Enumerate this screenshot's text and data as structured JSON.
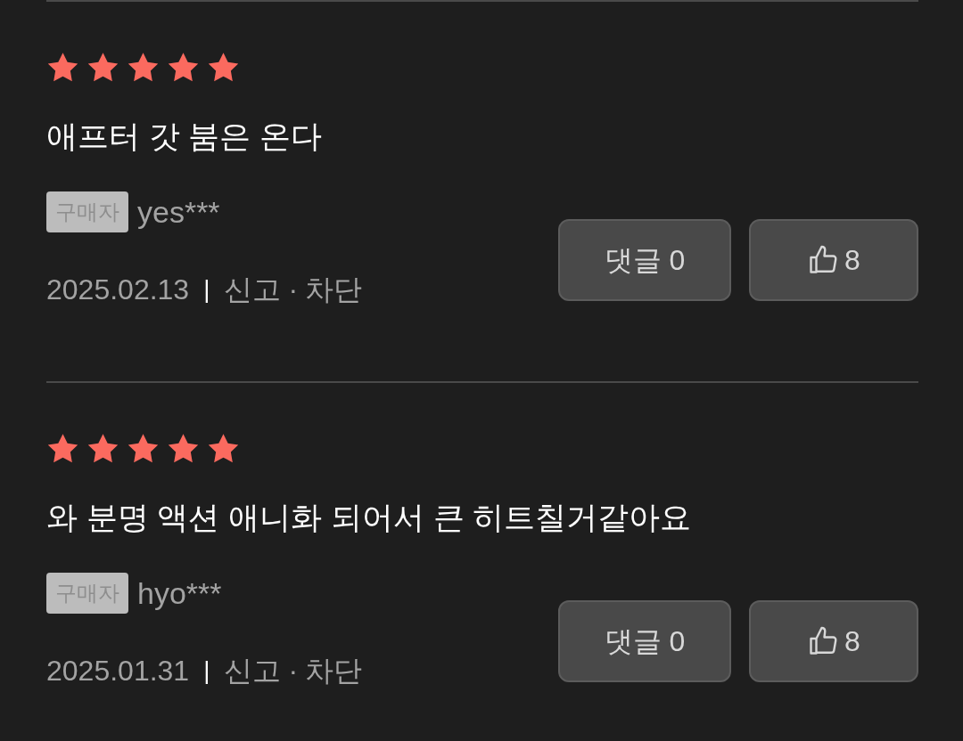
{
  "reviews": [
    {
      "stars": 5,
      "text": "애프터 갓 붐은 온다",
      "badge": "구매자",
      "user": "yes***",
      "date": "2025.02.13",
      "separator": "|",
      "report": "신고",
      "dot": "·",
      "block": "차단",
      "comment_button": "댓글 0",
      "like_count": "8"
    },
    {
      "stars": 5,
      "text": "와 분명 액션 애니화 되어서 큰 히트칠거같아요",
      "badge": "구매자",
      "user": "hyo***",
      "date": "2025.01.31",
      "separator": "|",
      "report": "신고",
      "dot": "·",
      "block": "차단",
      "comment_button": "댓글 0",
      "like_count": "8"
    }
  ]
}
